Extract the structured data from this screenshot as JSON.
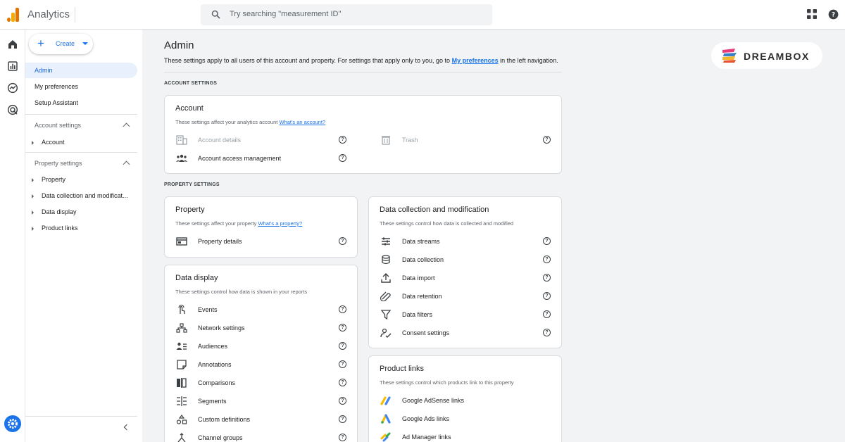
{
  "app": {
    "title": "Analytics"
  },
  "search": {
    "placeholder": "Try searching \"measurement ID\""
  },
  "sidebar": {
    "create_label": "Create",
    "items": [
      {
        "label": "Admin"
      },
      {
        "label": "My preferences"
      },
      {
        "label": "Setup Assistant"
      }
    ],
    "account_settings_label": "Account settings",
    "account_items": [
      {
        "label": "Account"
      }
    ],
    "property_settings_label": "Property settings",
    "property_items": [
      {
        "label": "Property"
      },
      {
        "label": "Data collection and modificat..."
      },
      {
        "label": "Data display"
      },
      {
        "label": "Product links"
      }
    ]
  },
  "main": {
    "title": "Admin",
    "intro_text": "These settings apply to all users of this account and property. For settings that apply only to you, go to",
    "intro_link": "My preferences",
    "intro_suffix": "in the left navigation.",
    "account_section_label": "ACCOUNT SETTINGS",
    "property_section_label": "PROPERTY SETTINGS"
  },
  "brand": {
    "name": "DREAMBOX"
  },
  "cards": {
    "account": {
      "title": "Account",
      "desc": "These settings affect your analytics account",
      "link": "What's an account?",
      "rows": [
        {
          "label": "Account details",
          "icon": "building-icon"
        },
        {
          "label": "Trash",
          "icon": "trash-icon"
        },
        {
          "label": "Account access management",
          "icon": "people-icon"
        }
      ]
    },
    "property": {
      "title": "Property",
      "desc": "These settings affect your property",
      "link": "What's a property?",
      "rows": [
        {
          "label": "Property details",
          "icon": "card-icon"
        }
      ]
    },
    "data_collection": {
      "title": "Data collection and modification",
      "desc": "These settings control how data is collected and modified",
      "rows": [
        {
          "label": "Data streams",
          "icon": "streams-icon"
        },
        {
          "label": "Data collection",
          "icon": "database-icon"
        },
        {
          "label": "Data import",
          "icon": "upload-icon"
        },
        {
          "label": "Data retention",
          "icon": "retention-icon"
        },
        {
          "label": "Data filters",
          "icon": "filter-icon"
        },
        {
          "label": "Consent settings",
          "icon": "consent-icon"
        }
      ]
    },
    "data_display": {
      "title": "Data display",
      "desc": "These settings control how data is shown in your reports",
      "rows": [
        {
          "label": "Events",
          "icon": "touch-icon"
        },
        {
          "label": "Network settings",
          "icon": "network-icon"
        },
        {
          "label": "Audiences",
          "icon": "audiences-icon"
        },
        {
          "label": "Annotations",
          "icon": "note-icon"
        },
        {
          "label": "Comparisons",
          "icon": "compare-icon"
        },
        {
          "label": "Segments",
          "icon": "segments-icon"
        },
        {
          "label": "Custom definitions",
          "icon": "shapes-icon"
        },
        {
          "label": "Channel groups",
          "icon": "channel-icon"
        }
      ]
    },
    "product_links": {
      "title": "Product links",
      "desc": "These settings control which products link to this property",
      "rows": [
        {
          "label": "Google AdSense links",
          "icon": "adsense-icon"
        },
        {
          "label": "Google Ads links",
          "icon": "google-ads-icon"
        },
        {
          "label": "Ad Manager links",
          "icon": "ad-manager-icon"
        }
      ]
    }
  },
  "colors": {
    "accent": "#1a73e8",
    "active_bg": "#e8f0fe",
    "page_bg": "#f1f3f4"
  }
}
